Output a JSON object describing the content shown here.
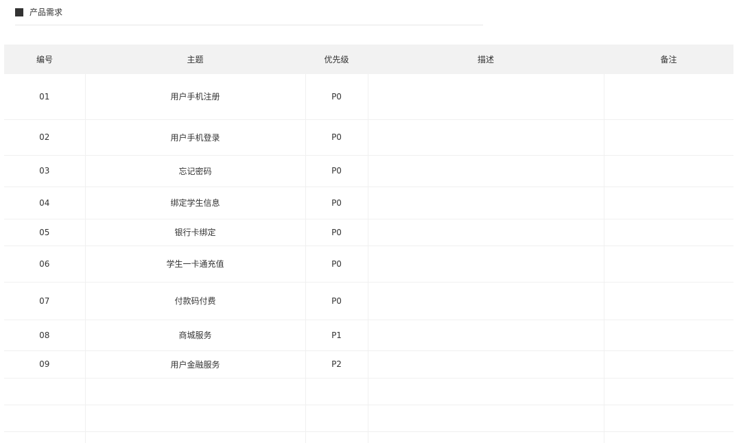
{
  "section": {
    "title": "产品需求"
  },
  "table": {
    "headers": [
      "编号",
      "主题",
      "优先级",
      "描述",
      "备注"
    ],
    "rows": [
      [
        "01",
        "用户手机注册",
        "P0",
        "",
        ""
      ],
      [
        "02",
        "用户手机登录",
        "P0",
        "",
        ""
      ],
      [
        "03",
        "忘记密码",
        "P0",
        "",
        ""
      ],
      [
        "04",
        "绑定学生信息",
        "P0",
        "",
        ""
      ],
      [
        "05",
        "银行卡绑定",
        "P0",
        "",
        ""
      ],
      [
        "06",
        "学生一卡通充值",
        "P0",
        "",
        ""
      ],
      [
        "07",
        "付款码付费",
        "P0",
        "",
        ""
      ],
      [
        "08",
        "商城服务",
        "P1",
        "",
        ""
      ],
      [
        "09",
        "用户金融服务",
        "P2",
        "",
        ""
      ],
      [
        "",
        "",
        "",
        "",
        ""
      ],
      [
        "",
        "",
        "",
        "",
        ""
      ],
      [
        "",
        "",
        "",
        "",
        ""
      ]
    ]
  }
}
